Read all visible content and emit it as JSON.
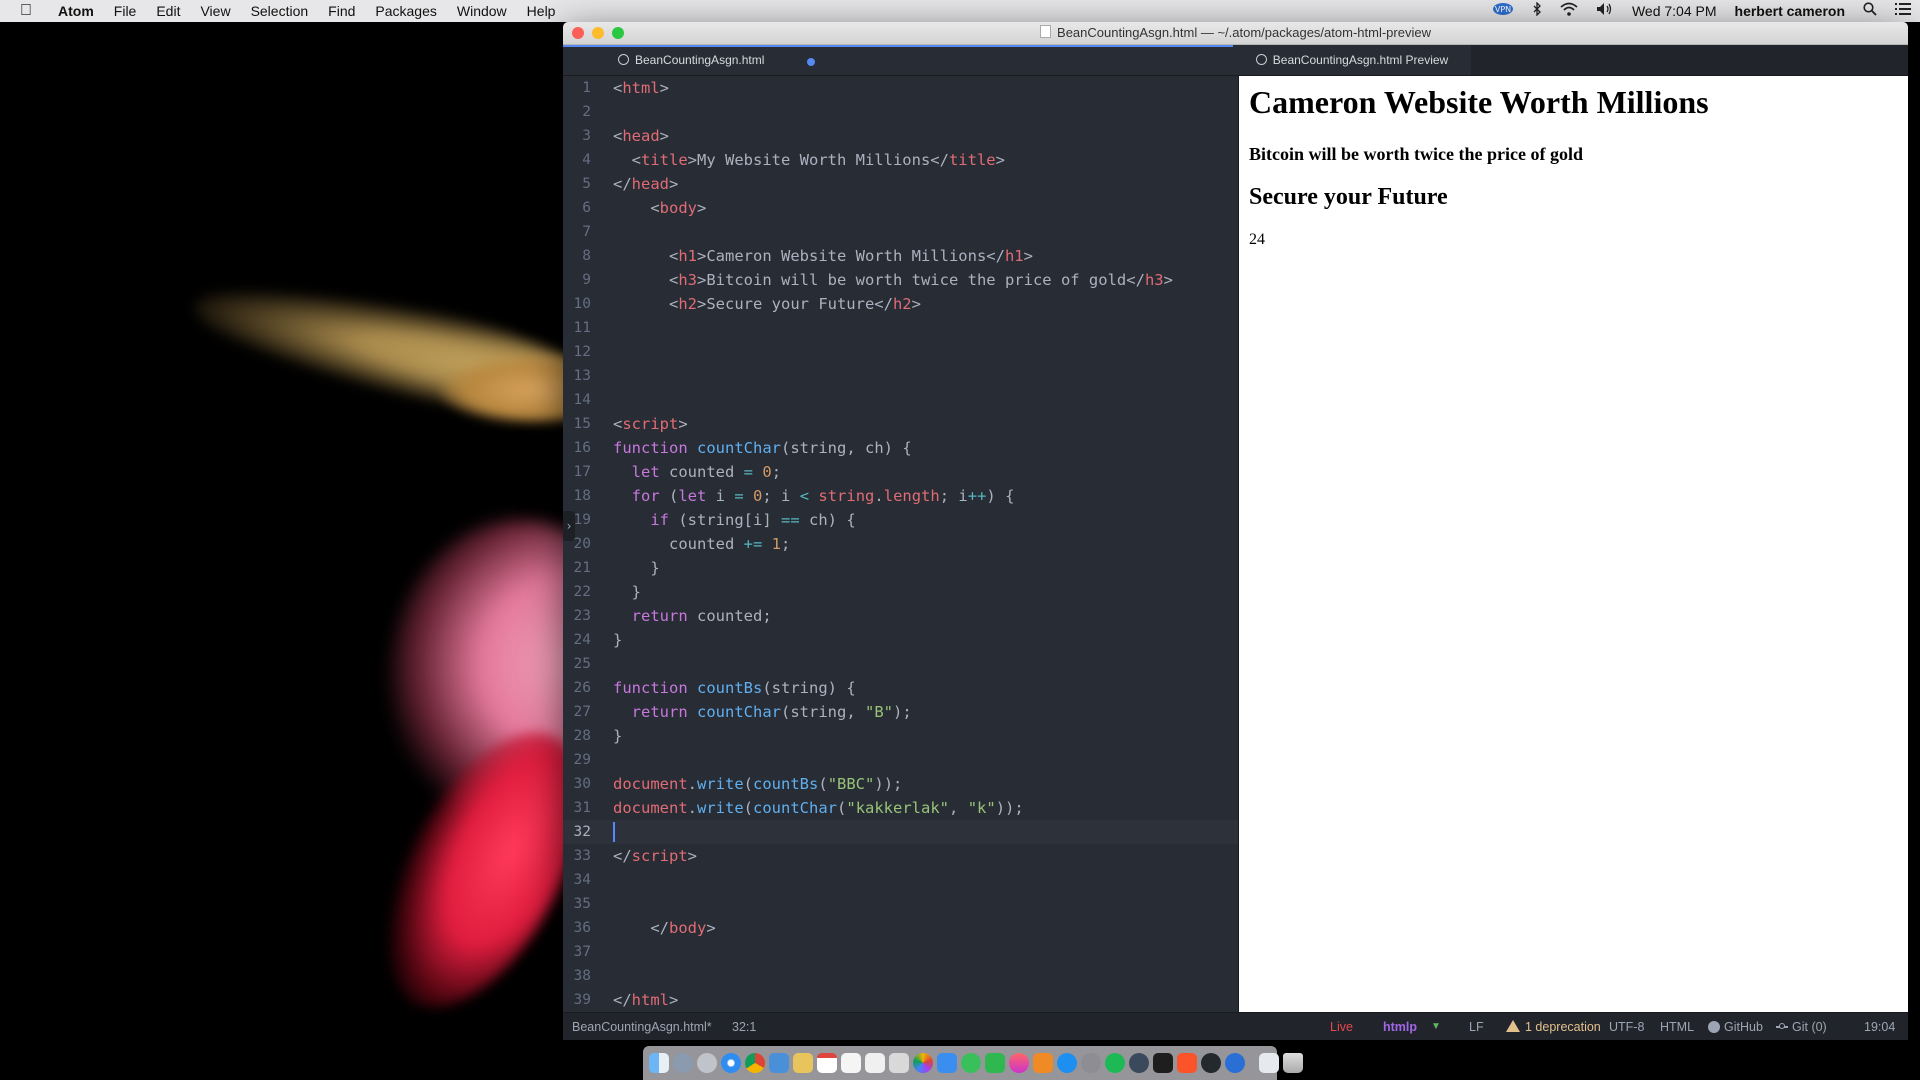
{
  "menubar": {
    "apple_glyph": "",
    "app_name": "Atom",
    "items": [
      "File",
      "Edit",
      "View",
      "Selection",
      "Find",
      "Packages",
      "Window",
      "Help"
    ],
    "status": {
      "datetime": "Wed 7:04 PM",
      "user": "herbert cameron",
      "icons": [
        "vpn-icon",
        "bluetooth-icon",
        "wifi-icon",
        "volume-icon",
        "spotlight-icon",
        "notification-center-icon"
      ]
    }
  },
  "window": {
    "title": "BeanCountingAsgn.html — ~/.atom/packages/atom-html-preview",
    "tabs": {
      "editor": "BeanCountingAsgn.html",
      "preview": "BeanCountingAsgn.html Preview"
    }
  },
  "editor": {
    "line_numbers": [
      "1",
      "2",
      "3",
      "4",
      "5",
      "6",
      "7",
      "8",
      "9",
      "10",
      "11",
      "12",
      "13",
      "14",
      "15",
      "16",
      "17",
      "18",
      "19",
      "20",
      "21",
      "22",
      "23",
      "24",
      "25",
      "26",
      "27",
      "28",
      "29",
      "30",
      "31",
      "32",
      "33",
      "34",
      "35",
      "36",
      "37",
      "38",
      "39"
    ],
    "current_line": "32"
  },
  "preview": {
    "h1": "Cameron Website Worth Millions",
    "h3": "Bitcoin will be worth twice the price of gold",
    "h2": "Secure your Future",
    "output": "24"
  },
  "statusbar": {
    "file": "BeanCountingAsgn.html*",
    "cursor_pos": "32:1",
    "live": "Live",
    "htmlp": "htmlp",
    "line_ending": "LF",
    "deprecation": "1 deprecation",
    "encoding": "UTF-8",
    "grammar": "HTML",
    "github": "GitHub",
    "git": "Git (0)",
    "time": "19:04"
  },
  "colors": {
    "editor_bg": "#282c34",
    "chrome_bg": "#21252b",
    "accent": "#568af2",
    "tag": "#e06c75",
    "keyword": "#c678dd",
    "function": "#61afef",
    "number": "#d19a66",
    "string": "#98c379"
  },
  "dock": {
    "icons": [
      "finder-icon",
      "launchpad-icon",
      "rocket-icon",
      "safari-icon",
      "chrome-icon",
      "preview-icon",
      "notes-icon",
      "calendar-icon",
      "reminders-icon",
      "textedit-icon",
      "photos-icon",
      "photos-app-icon",
      "contacts-icon",
      "messages-icon",
      "facetime-icon",
      "itunes-icon",
      "ibooks-icon",
      "appstore-icon",
      "preferences-icon",
      "spotify-icon",
      "atom-icon",
      "terminal-icon",
      "brave-icon",
      "github-icon",
      "xcode-icon",
      "downloads-icon",
      "trash-icon"
    ]
  }
}
